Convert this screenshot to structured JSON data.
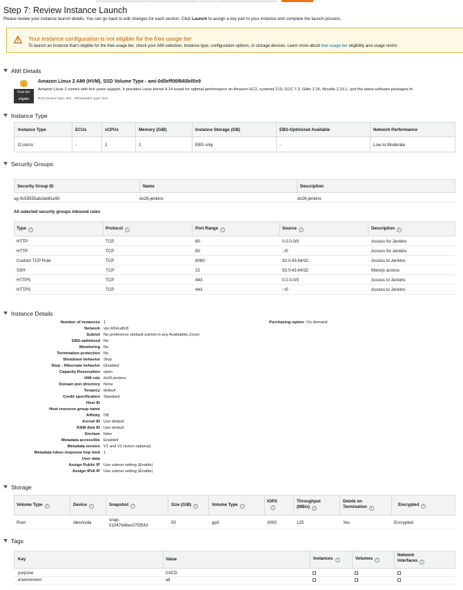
{
  "page": {
    "title": "Step 7: Review Instance Launch",
    "subtitle_pre": "Please review your instance launch details. You can go back to edit changes for each section. Click ",
    "subtitle_bold": "Launch",
    "subtitle_post": " to assign a key pair to your instance and complete the launch process."
  },
  "alert": {
    "title": "Your instance configuration is not eligible for the free usage tier",
    "text_pre": "To launch an instance that's eligible for the free usage tier, check your AMI selection, instance type, configuration options, or storage devices. Learn more about",
    "link": "free usage tier",
    "text_post": "eligibility and usage restric"
  },
  "ami": {
    "section": "AMI Details",
    "name": "Amazon Linux 2 AMI (HVM), SSD Volume Type - ami-0d5eff06f840b45e9",
    "description": "Amazon Linux 2 comes with five years support. It provides Linux kernel 4.14 tuned for optimal performance on Amazon EC2, systemd 219, GCC 7.3, Glibc 2.26, Binutils 2.29.1, and the latest software packages th",
    "badge_line1": "Free tier",
    "badge_line2": "eligible",
    "root_device": "Root Device Type: ebs",
    "virt_type": "Virtualization type: hvm"
  },
  "instance_type": {
    "section": "Instance Type",
    "headers": [
      "Instance Type",
      "ECUs",
      "vCPUs",
      "Memory (GiB)",
      "Instance Storage (GB)",
      "EBS-Optimized Available",
      "Network Performance"
    ],
    "row": [
      "t2.micro",
      "-",
      "1",
      "1",
      "EBS only",
      "-",
      "Low to Moderate"
    ]
  },
  "security_groups": {
    "section": "Security Groups",
    "headers": [
      "Security Group ID",
      "Name",
      "Description"
    ],
    "row": [
      "sg-0c59555ab2eb81e90",
      "dx26-jenkins",
      "dx26-jenkins"
    ],
    "rules_title": "All selected security groups inbound rules",
    "rule_headers": [
      "Type",
      "Protocol",
      "Port Range",
      "Source",
      "Description"
    ],
    "rules": [
      [
        "HTTP",
        "TCP",
        "80",
        "0.0.0.0/0",
        "Access for Jenkins"
      ],
      [
        "HTTP",
        "TCP",
        "80",
        "::/0",
        "Access for Jenkins"
      ],
      [
        "Custom TCP Rule",
        "TCP",
        "8080",
        "92.0.43.64/32",
        "Access to Jenkins"
      ],
      [
        "SSH",
        "TCP",
        "22",
        "92.0.43.64/32",
        "Manojs access"
      ],
      [
        "HTTPS",
        "TCP",
        "443",
        "0.0.0.0/0",
        "Access to Jenkins"
      ],
      [
        "HTTPS",
        "TCP",
        "443",
        "::/0",
        "Access to Jenkins"
      ]
    ]
  },
  "instance_details": {
    "section": "Instance Details",
    "rows": [
      [
        "Number of instances",
        "1"
      ],
      [
        "Network",
        "vpc-b54ca8c8"
      ],
      [
        "Subnet",
        "No preference (default subnet in any Availability Zone)"
      ],
      [
        "EBS-optimized",
        "No"
      ],
      [
        "Monitoring",
        "No"
      ],
      [
        "Termination protection",
        "No"
      ],
      [
        "Shutdown behavior",
        "Stop"
      ],
      [
        "Stop - Hibernate behavior",
        "Disabled"
      ],
      [
        "Capacity Reservation",
        "open"
      ],
      [
        "IAM role",
        "dx26-jenkins"
      ],
      [
        "Domain join directory",
        "None"
      ],
      [
        "Tenancy",
        "default"
      ],
      [
        "Credit specification",
        "Standard"
      ],
      [
        "Host ID",
        ""
      ],
      [
        "Host resource group name",
        ""
      ],
      [
        "Affinity",
        "Off"
      ],
      [
        "Kernel ID",
        "Use default"
      ],
      [
        "RAM disk ID",
        "Use default"
      ],
      [
        "Enclave",
        "false"
      ],
      [
        "Metadata accessible",
        "Enabled"
      ],
      [
        "Metadata version",
        "V1 and V2 (token optional)"
      ],
      [
        "Metadata token response hop limit",
        "1"
      ],
      [
        "User data",
        ""
      ],
      [
        "Assign Public IP",
        "Use subnet setting (Enable)"
      ],
      [
        "Assign IPv6 IP",
        "Use subnet setting (Enable)"
      ]
    ],
    "purchasing_label": "Purchasing option",
    "purchasing_value": "On demand"
  },
  "storage": {
    "section": "Storage",
    "headers": [
      "Volume Type",
      "Device",
      "Snapshot",
      "Size (GiB)",
      "Volume Type",
      "IOPS",
      "Throughput (MB/s)",
      "Delete on Termination",
      "Encrypted"
    ],
    "row": [
      "Root",
      "/dev/xvda",
      "snap-",
      "01047646ec075f543",
      "50",
      "gp3",
      "3000",
      "125",
      "Yes",
      "Encrypted"
    ]
  },
  "tags": {
    "section": "Tags",
    "headers": [
      "Key",
      "Value",
      "Instances",
      "Volumes",
      "Network",
      "Interfaces"
    ],
    "rows": [
      [
        "purpose",
        "CI/CD"
      ],
      [
        "environment",
        "all"
      ]
    ]
  }
}
